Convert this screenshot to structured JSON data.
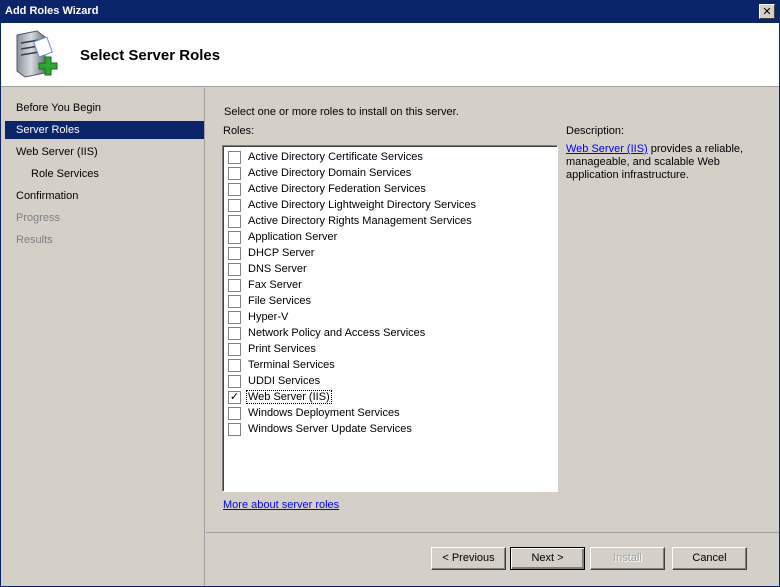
{
  "window": {
    "title": "Add Roles Wizard",
    "close_glyph": "✕"
  },
  "header": {
    "title": "Select Server Roles",
    "icon": "server-add-icon"
  },
  "nav": {
    "items": [
      {
        "label": "Before You Begin",
        "state": "normal",
        "sub": false
      },
      {
        "label": "Server Roles",
        "state": "active",
        "sub": false
      },
      {
        "label": "Web Server (IIS)",
        "state": "normal",
        "sub": false
      },
      {
        "label": "Role Services",
        "state": "normal",
        "sub": true
      },
      {
        "label": "Confirmation",
        "state": "normal",
        "sub": false
      },
      {
        "label": "Progress",
        "state": "disabled",
        "sub": false
      },
      {
        "label": "Results",
        "state": "disabled",
        "sub": false
      }
    ]
  },
  "content": {
    "instruction": "Select one or more roles to install on this server.",
    "roles_label": "Roles:",
    "roles": [
      {
        "label": "Active Directory Certificate Services",
        "checked": false
      },
      {
        "label": "Active Directory Domain Services",
        "checked": false
      },
      {
        "label": "Active Directory Federation Services",
        "checked": false
      },
      {
        "label": "Active Directory Lightweight Directory Services",
        "checked": false
      },
      {
        "label": "Active Directory Rights Management Services",
        "checked": false
      },
      {
        "label": "Application Server",
        "checked": false
      },
      {
        "label": "DHCP Server",
        "checked": false
      },
      {
        "label": "DNS Server",
        "checked": false
      },
      {
        "label": "Fax Server",
        "checked": false
      },
      {
        "label": "File Services",
        "checked": false
      },
      {
        "label": "Hyper-V",
        "checked": false
      },
      {
        "label": "Network Policy and Access Services",
        "checked": false
      },
      {
        "label": "Print Services",
        "checked": false
      },
      {
        "label": "Terminal Services",
        "checked": false
      },
      {
        "label": "UDDI Services",
        "checked": false
      },
      {
        "label": "Web Server (IIS)",
        "checked": true
      },
      {
        "label": "Windows Deployment Services",
        "checked": false
      },
      {
        "label": "Windows Server Update Services",
        "checked": false
      }
    ],
    "description_label": "Description:",
    "description_link": "Web Server (IIS)",
    "description_text": " provides a reliable, manageable, and scalable Web application infrastructure.",
    "more_link": "More about server roles"
  },
  "footer": {
    "previous": "< Previous",
    "next": "Next >",
    "install": "Install",
    "cancel": "Cancel"
  },
  "colors": {
    "accent": "#0a246a",
    "face": "#d4d0c8",
    "link": "#0000ff"
  }
}
